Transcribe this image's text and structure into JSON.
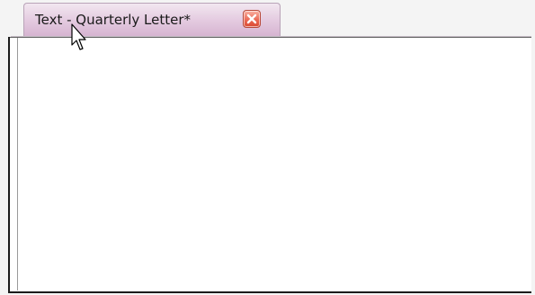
{
  "tab": {
    "title": "Text - Quarterly Letter*",
    "close_icon": "close-icon",
    "accent_color": "#e3c9df"
  },
  "editor": {
    "content": ""
  },
  "cursor": {
    "icon": "mouse-pointer-icon"
  }
}
